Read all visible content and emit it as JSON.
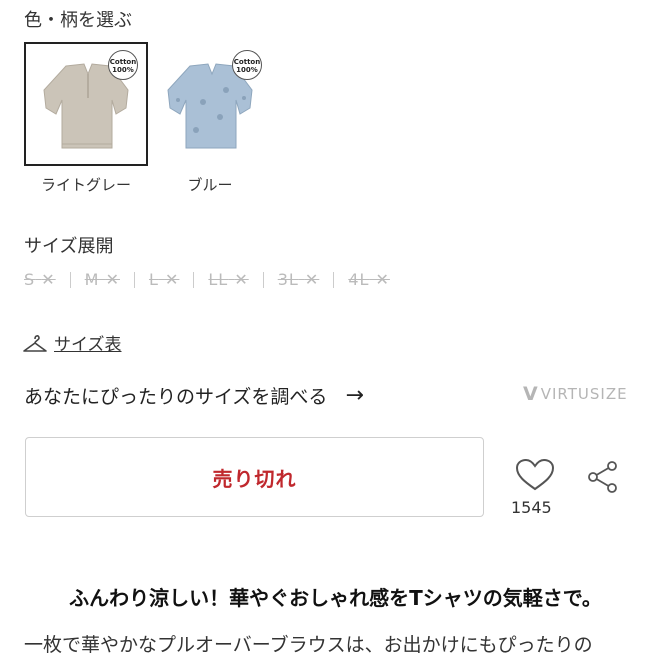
{
  "color_section": {
    "label": "色・柄を選ぶ",
    "options": [
      {
        "name": "ライトグレー",
        "badge_top": "Cotton",
        "badge_bottom": "100%",
        "selected": true,
        "fabric_color": "#c9c2b6"
      },
      {
        "name": "ブルー",
        "badge_top": "Cotton",
        "badge_bottom": "100%",
        "selected": false,
        "fabric_color": "#a9bfd4"
      }
    ]
  },
  "size_section": {
    "label": "サイズ展開",
    "options": [
      {
        "label": "S",
        "available": false
      },
      {
        "label": "M",
        "available": false
      },
      {
        "label": "L",
        "available": false
      },
      {
        "label": "LL",
        "available": false
      },
      {
        "label": "3L",
        "available": false
      },
      {
        "label": "4L",
        "available": false
      }
    ],
    "unavailable_mark": "✕"
  },
  "size_chart": {
    "label": "サイズ表",
    "icon": "hanger-icon"
  },
  "find_size": {
    "label": "あなたにぴったりのサイズを調べる",
    "arrow": "→",
    "brand": "VIRTUSIZE"
  },
  "purchase": {
    "sold_out_label": "売り切れ",
    "accent_color": "#c0282d"
  },
  "favorite": {
    "count": "1545",
    "icon": "heart-icon"
  },
  "share": {
    "icon": "share-icon"
  },
  "description": {
    "headline": "ふんわり涼しい！華やぐおしゃれ感をTシャツの気軽さで。",
    "body": "一枚で華やかなプルオーバーブラウスは、お出かけにもぴったりの"
  }
}
